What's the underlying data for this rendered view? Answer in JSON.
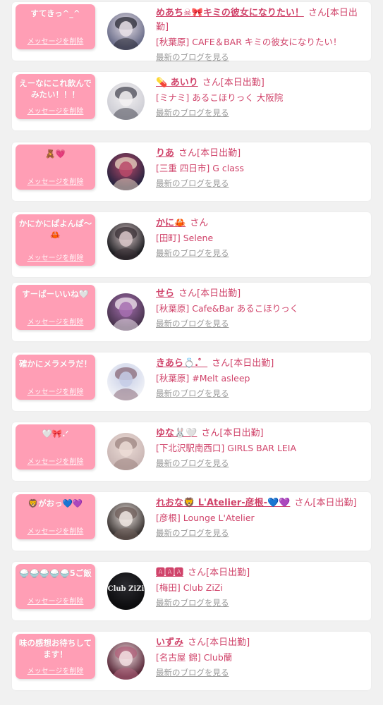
{
  "delete_label": "メッセージを削除",
  "blog_label": "最新のブログを見る",
  "colors": {
    "accent": "#d0436a",
    "bubble": "#ff9eb5",
    "muted": "#9a9a9a"
  },
  "entries": [
    {
      "message": "すてきっ^_^",
      "name": "めあち☠🎀キミの彼女になりたい！",
      "honorific": "さん",
      "status": "[本日出勤]",
      "shop": "[秋葉原] CAFE＆BAR キミの彼女になりたい！",
      "avatar_icon": "avatar-photo-icon",
      "avatar_colors": [
        "#6b6e8a",
        "#e8e0e8",
        "#2a2a34"
      ]
    },
    {
      "message": "えーなにこれ飲んでみたい！！！",
      "name": "💊 あいり",
      "honorific": "さん",
      "status": "[本日出勤]",
      "shop": "[ミナミ] あるこほりっく 大阪院",
      "avatar_icon": "avatar-photo-icon",
      "avatar_colors": [
        "#cfcfd6",
        "#f3f1f2",
        "#4a4a55"
      ]
    },
    {
      "message": "🧸💗",
      "name": "りあ",
      "honorific": "さん",
      "status": "[本日出勤]",
      "shop": "[三重 四日市] G class",
      "avatar_icon": "avatar-photo-icon",
      "avatar_colors": [
        "#2a2440",
        "#b84a6a",
        "#e9d5c2"
      ]
    },
    {
      "message": "かにかにぱよんぱ〜🦀",
      "name": "かに🦀",
      "honorific": "さん",
      "status": "",
      "shop": "[田町] Selene",
      "avatar_icon": "avatar-photo-icon",
      "avatar_colors": [
        "#1c1c20",
        "#d8c6c8",
        "#3a3035"
      ]
    },
    {
      "message": "すーぱーいいね🤍",
      "name": "せら",
      "honorific": "さん",
      "status": "[本日出勤]",
      "shop": "[秋葉原] Cafe&Bar あるこほりっく",
      "avatar_icon": "avatar-photo-icon",
      "avatar_colors": [
        "#4a3550",
        "#a66fb0",
        "#f0e6ee"
      ]
    },
    {
      "message": "確かにメラメラだ！",
      "name": "きあら💍.゜",
      "honorific": "さん",
      "status": "[本日出勤]",
      "shop": "[秋葉原] #Melt asleep",
      "avatar_icon": "avatar-photo-icon",
      "avatar_colors": [
        "#eef0f6",
        "#c6cde6",
        "#8a6a78"
      ]
    },
    {
      "message": "🤍🎀.ᐟ",
      "name": "ゆな🐰🤍",
      "honorific": "さん",
      "status": "[本日出勤]",
      "shop": "[下北沢駅南西口] GIRLS BAR LEIA",
      "avatar_icon": "avatar-photo-icon",
      "avatar_colors": [
        "#cbb8b6",
        "#ecdcd6",
        "#9c8480"
      ]
    },
    {
      "message": "🦁がおっ💙💜",
      "name": "れおな🦁 L'Atelier-彦根-💙💜",
      "honorific": "さん",
      "status": "[本日出勤]",
      "shop": "[彦根] Lounge L'Atelier",
      "avatar_icon": "avatar-photo-icon",
      "avatar_colors": [
        "#3a3432",
        "#efe6e2",
        "#6e5c58"
      ]
    },
    {
      "message": "🍚🍚🍚🍚🍚5ご飯",
      "name": "🅰🅰🅰",
      "honorific": "さん",
      "status": "[本日出勤]",
      "shop": "[梅田] Club ZiZi",
      "avatar_icon": "club-logo-icon",
      "avatar_colors": [
        "#0d0d0f",
        "#2b2b30",
        "#e8e8e8"
      ],
      "avatar_text": "Club ZiZi"
    },
    {
      "message": "味の感想お待ちしてます！",
      "name": "いずみ",
      "honorific": "さん",
      "status": "[本日出勤]",
      "shop": "[名古屋 錦] Club蘭",
      "avatar_icon": "avatar-photo-icon",
      "avatar_colors": [
        "#5a2a3a",
        "#f2dfe2",
        "#b0607a"
      ]
    }
  ]
}
